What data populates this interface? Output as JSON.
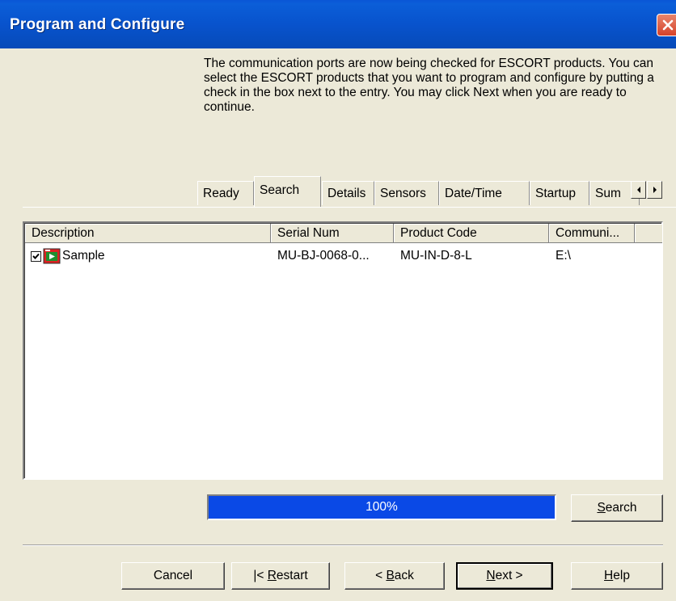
{
  "window": {
    "title": "Program and Configure"
  },
  "instructions": "The communication ports are now being checked for ESCORT products. You can select the ESCORT products that you want to program and configure by putting a check in the box next to the entry. You may click Next when you are ready to continue.",
  "tabs": [
    {
      "label": "Ready",
      "active": false
    },
    {
      "label": "Search",
      "active": true
    },
    {
      "label": "Details",
      "active": false
    },
    {
      "label": "Sensors",
      "active": false
    },
    {
      "label": "Date/Time",
      "active": false
    },
    {
      "label": "Startup",
      "active": false
    },
    {
      "label": "Sum",
      "active": false
    }
  ],
  "list": {
    "columns": [
      "Description",
      "Serial Num",
      "Product Code",
      "Communi..."
    ],
    "rows": [
      {
        "checked": true,
        "description": "Sample",
        "serial_num": "MU-BJ-0068-0...",
        "product_code": "MU-IN-D-8-L",
        "communication": "E:\\"
      }
    ]
  },
  "progress": {
    "value": 100,
    "label": "100%",
    "color": "#0a49e6"
  },
  "search_button": {
    "label": "Search",
    "mnemonic": "S",
    "rest": "earch"
  },
  "buttons": {
    "cancel": {
      "label": "Cancel"
    },
    "restart": {
      "label": "|< Restart",
      "prefix": "|< ",
      "mnemonic": "R",
      "rest": "estart"
    },
    "back": {
      "label": "< Back",
      "prefix": "< ",
      "mnemonic": "B",
      "rest": "ack"
    },
    "next": {
      "label": "Next >",
      "mnemonic": "N",
      "rest": "ext >"
    },
    "help": {
      "label": "Help",
      "mnemonic": "H",
      "rest": "elp"
    }
  },
  "icons": {
    "close": "close-icon",
    "scroll_left": "arrow-left-icon",
    "scroll_right": "arrow-right-icon",
    "row": "logger-device-icon",
    "check": "checkmark-icon"
  }
}
